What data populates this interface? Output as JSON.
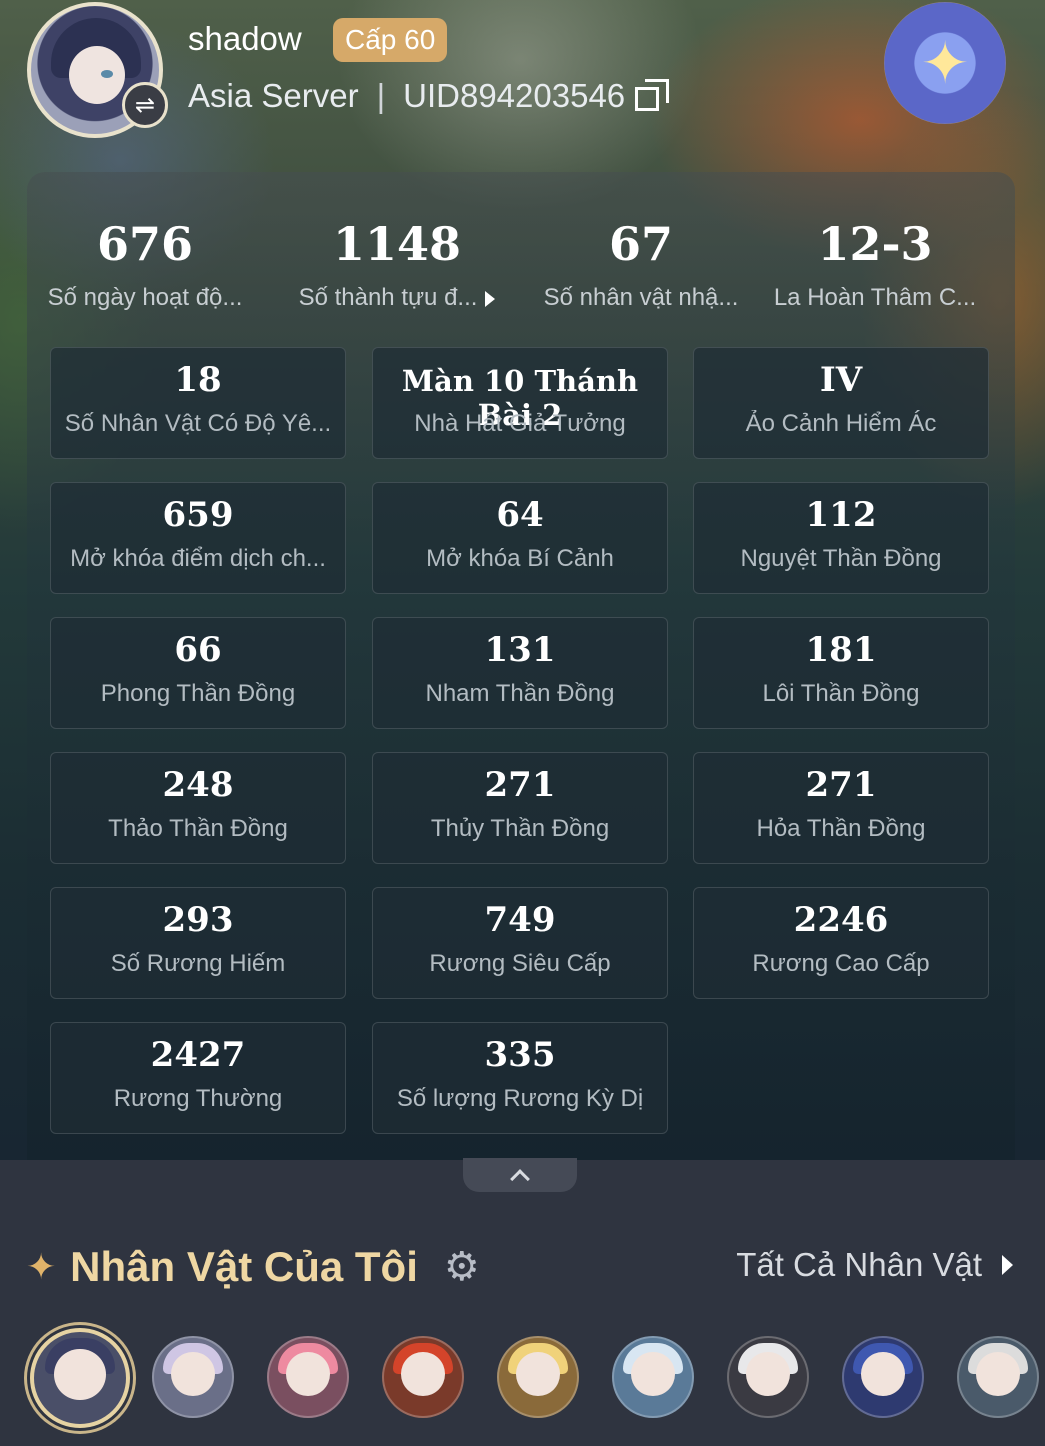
{
  "profile": {
    "username": "shadow",
    "level": "Cấp 60",
    "server": "Asia Server",
    "separator": "|",
    "uid": "UID894203546",
    "switch_icon": "⇌",
    "emblem_icon": "✦"
  },
  "summary": [
    {
      "value": "676",
      "label": "Số ngày hoạt độ..."
    },
    {
      "value": "1148",
      "label": "Số thành tựu đ..."
    },
    {
      "value": "67",
      "label": "Số nhân vật nhậ..."
    },
    {
      "value": "12-3",
      "label": "La Hoàn Thâm C..."
    }
  ],
  "stats": [
    {
      "value": "18",
      "label": "Số Nhân Vật Có Độ Yê..."
    },
    {
      "value": "Màn 10 Thánh Bài 2",
      "label": "Nhà Hát Giả Tưởng"
    },
    {
      "value": "IV",
      "label": "Ảo Cảnh Hiểm Ác"
    },
    {
      "value": "659",
      "label": "Mở khóa điểm dịch ch..."
    },
    {
      "value": "64",
      "label": "Mở khóa Bí Cảnh"
    },
    {
      "value": "112",
      "label": "Nguyệt Thần Đồng"
    },
    {
      "value": "66",
      "label": "Phong Thần Đồng"
    },
    {
      "value": "131",
      "label": "Nham Thần Đồng"
    },
    {
      "value": "181",
      "label": "Lôi Thần Đồng"
    },
    {
      "value": "248",
      "label": "Thảo Thần Đồng"
    },
    {
      "value": "271",
      "label": "Thủy Thần Đồng"
    },
    {
      "value": "271",
      "label": "Hỏa Thần Đồng"
    },
    {
      "value": "293",
      "label": "Số Rương Hiếm"
    },
    {
      "value": "749",
      "label": "Rương Siêu Cấp"
    },
    {
      "value": "2246",
      "label": "Rương Cao Cấp"
    },
    {
      "value": "2427",
      "label": "Rương Thường"
    },
    {
      "value": "335",
      "label": "Số lượng Rương Kỳ Dị"
    }
  ],
  "characters_section": {
    "title": "Nhân Vật Của Tôi",
    "sparkle_icon": "✦",
    "gear_icon": "⚙",
    "all_link": "Tất Cả Nhân Vật"
  },
  "characters": [
    {
      "hair": "#3a3f63",
      "bg": "#4a4f68"
    },
    {
      "hair": "#cfc6e4",
      "bg": "#6a6f88"
    },
    {
      "hair": "#ee8aa0",
      "bg": "#7a4f60"
    },
    {
      "hair": "#d4442a",
      "bg": "#7a3a2a"
    },
    {
      "hair": "#f0d27a",
      "bg": "#8a6a3a"
    },
    {
      "hair": "#d8e6f2",
      "bg": "#5a7a98"
    },
    {
      "hair": "#e8e8ea",
      "bg": "#3a3a42"
    },
    {
      "hair": "#3f58b0",
      "bg": "#2e3a70"
    },
    {
      "hair": "#dcdcdc",
      "bg": "#4a5a6a"
    }
  ]
}
